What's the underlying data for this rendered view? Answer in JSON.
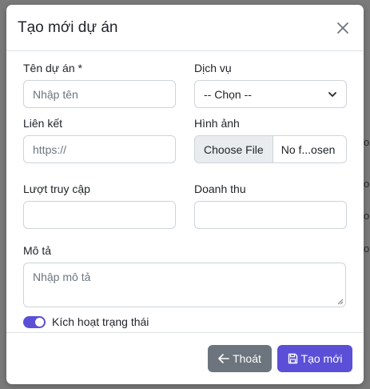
{
  "modal": {
    "title": "Tạo mới dự án"
  },
  "form": {
    "name": {
      "label": "Tên dự án *",
      "placeholder": "Nhập tên",
      "value": ""
    },
    "service": {
      "label": "Dịch vụ",
      "selected": "-- Chọn --"
    },
    "link": {
      "label": "Liên kết",
      "placeholder": "https://",
      "value": ""
    },
    "image": {
      "label": "Hình ảnh",
      "button": "Choose File",
      "filename": "No f...osen"
    },
    "visits": {
      "label": "Lượt truy cập",
      "value": ""
    },
    "revenue": {
      "label": "Doanh thu",
      "value": ""
    },
    "description": {
      "label": "Mô tả",
      "placeholder": "Nhập mô tả",
      "value": ""
    },
    "active": {
      "label": "Kích hoạt trạng thái",
      "checked": true
    }
  },
  "footer": {
    "exit_label": "Thoát",
    "create_label": "Tạo mới"
  },
  "colors": {
    "accent": "#5b4fd8",
    "secondary": "#6c757d"
  },
  "icons": {
    "close": "close-icon",
    "chevron": "chevron-down-icon",
    "exit": "arrow-left-icon",
    "create": "save-icon"
  }
}
